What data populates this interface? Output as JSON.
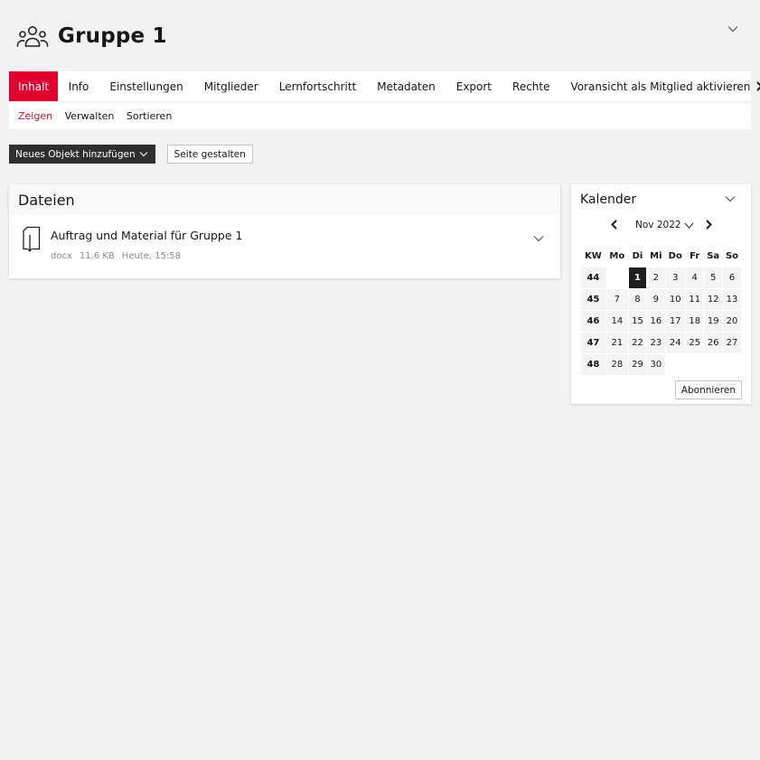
{
  "header": {
    "title": "Gruppe 1",
    "icon": "group-icon"
  },
  "tabs": [
    {
      "label": "Inhalt",
      "active": true
    },
    {
      "label": "Info"
    },
    {
      "label": "Einstellungen"
    },
    {
      "label": "Mitglieder"
    },
    {
      "label": "Lernfortschritt"
    },
    {
      "label": "Metadaten"
    },
    {
      "label": "Export"
    },
    {
      "label": "Rechte"
    },
    {
      "label": "Voransicht als Mitglied aktivieren"
    }
  ],
  "subtabs": [
    {
      "label": "Zeigen",
      "active": true
    },
    {
      "label": "Verwalten"
    },
    {
      "label": "Sortieren"
    }
  ],
  "toolbar": {
    "add_label": "Neues Objekt hinzufügen",
    "design_label": "Seite gestalten"
  },
  "files_panel": {
    "title": "Dateien",
    "items": [
      {
        "title": "Auftrag und Material für Gruppe 1",
        "type": "docx",
        "size": "11,6 KB",
        "date": "Heute, 15:58"
      }
    ]
  },
  "calendar": {
    "title": "Kalender",
    "month": "Nov 2022",
    "headers": [
      "KW",
      "Mo",
      "Di",
      "Mi",
      "Do",
      "Fr",
      "Sa",
      "So"
    ],
    "weeks": [
      [
        "44",
        "",
        "1",
        "2",
        "3",
        "4",
        "5",
        "6"
      ],
      [
        "45",
        "7",
        "8",
        "9",
        "10",
        "11",
        "12",
        "13"
      ],
      [
        "46",
        "14",
        "15",
        "16",
        "17",
        "18",
        "19",
        "20"
      ],
      [
        "47",
        "21",
        "22",
        "23",
        "24",
        "25",
        "26",
        "27"
      ],
      [
        "48",
        "28",
        "29",
        "30",
        "",
        "",
        "",
        ""
      ]
    ],
    "today": "1",
    "subscribe_label": "Abonnieren"
  },
  "colors": {
    "accent": "#e0002f",
    "dark_button": "#2f2f2f",
    "background": "#f2f2f2"
  }
}
